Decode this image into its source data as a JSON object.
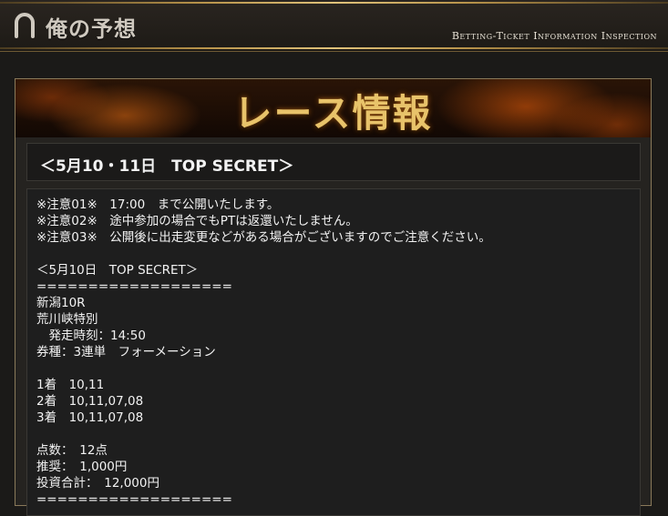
{
  "header": {
    "title": "俺の予想",
    "subtitle": "Betting-Ticket Information Inspection"
  },
  "banner": {
    "title": "レース情報"
  },
  "race_box": {
    "title": "＜5月10・11日　TOP SECRET＞"
  },
  "content": {
    "notice_1": "※注意01※　17:00　まで公開いたします。",
    "notice_2": "※注意02※　途中参加の場合でもPTは返還いたしません。",
    "notice_3": "※注意03※　公開後に出走変更などがある場合がございますのでご注意ください。",
    "section_title": "＜5月10日　TOP SECRET＞",
    "separator": "===================",
    "venue": "新潟10R",
    "race_name": "荒川峡特別",
    "start_time": "　発走時刻：14:50",
    "ticket_type": "券種：3連単　フォーメーション",
    "first": "1着　10,11",
    "second": "2着　10,11,07,08",
    "third": "3着　10,11,07,08",
    "points": "点数：　12点",
    "recommended": "推奨：　1,000円",
    "total": "投資合計：　12,000円",
    "separator_2": "==================="
  }
}
